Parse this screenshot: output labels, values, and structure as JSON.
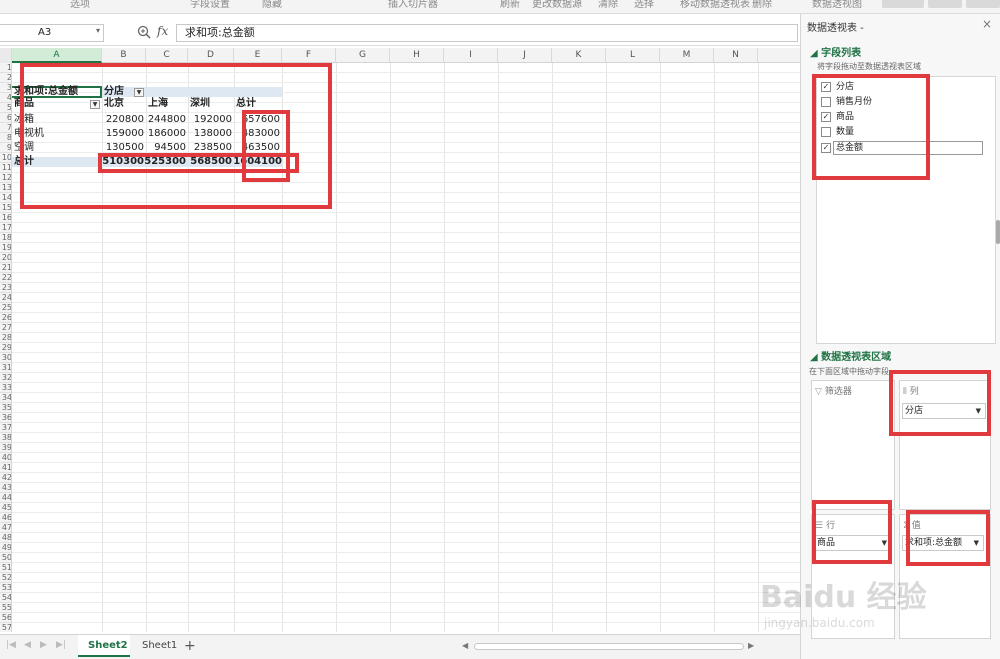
{
  "ribbon": {
    "partial_labels": [
      "选项",
      "字段设置",
      "隐藏",
      "插入切片器",
      "刷新",
      "更改数据源",
      "清除",
      "选择",
      "移动数据透视表",
      "删除",
      "数据透视图"
    ]
  },
  "formula_bar": {
    "cell_ref": "A3",
    "fx_label": "fx",
    "content": "求和项:总金额"
  },
  "columns": [
    "A",
    "B",
    "C",
    "D",
    "E",
    "F",
    "G",
    "H",
    "I",
    "J",
    "K",
    "L",
    "M",
    "N"
  ],
  "active_column": "A",
  "rows": [
    "1",
    "2",
    "3",
    "4",
    "5",
    "6",
    "7",
    "8",
    "9",
    "10",
    "11",
    "12",
    "13",
    "14",
    "15",
    "16",
    "17",
    "18",
    "19",
    "20",
    "21",
    "22",
    "23",
    "24",
    "25",
    "26",
    "27",
    "28",
    "29",
    "30",
    "31",
    "32",
    "33",
    "34",
    "35",
    "36",
    "37",
    "38",
    "39",
    "40",
    "41",
    "42",
    "43",
    "44",
    "45",
    "46",
    "47",
    "48",
    "49",
    "50",
    "51",
    "52",
    "53",
    "54",
    "55",
    "56",
    "57"
  ],
  "pivot": {
    "value_label": "求和项:总金额",
    "col_field": "分店",
    "row_field": "商品",
    "col_items": [
      "北京",
      "上海",
      "深圳",
      "总计"
    ],
    "rows": [
      {
        "label": "冰箱",
        "values": [
          "220800",
          "244800",
          "192000",
          "657600"
        ]
      },
      {
        "label": "电视机",
        "values": [
          "159000",
          "186000",
          "138000",
          "483000"
        ]
      },
      {
        "label": "空调",
        "values": [
          "130500",
          "94500",
          "238500",
          "463500"
        ]
      }
    ],
    "total": {
      "label": "总计",
      "values": [
        "510300",
        "525300",
        "568500",
        "1604100"
      ]
    }
  },
  "sheets": {
    "tabs": [
      "Sheet2",
      "Sheet1"
    ],
    "active": "Sheet2",
    "add": "+"
  },
  "pane": {
    "title": "数据透视表 -",
    "close": "×",
    "field_section": {
      "title": "字段列表",
      "hint": "将字段拖动至数据透视表区域"
    },
    "fields": [
      {
        "label": "分店",
        "checked": true
      },
      {
        "label": "销售月份",
        "checked": false
      },
      {
        "label": "商品",
        "checked": true
      },
      {
        "label": "数量",
        "checked": false
      },
      {
        "label": "总金额",
        "checked": true
      }
    ],
    "area_section": {
      "title": "数据透视表区域",
      "hint": "在下面区域中拖动字段"
    },
    "zones": {
      "filter": {
        "title": "筛选器",
        "icon": "filter-icon"
      },
      "columns": {
        "title": "列",
        "icon": "columns-icon",
        "field": "分店"
      },
      "rows": {
        "title": "行",
        "icon": "rows-icon",
        "field": "商品"
      },
      "values": {
        "title": "值",
        "icon": "sigma-icon",
        "field": "求和项:总金额"
      }
    }
  },
  "watermark": {
    "main": "Baidu 经验",
    "sub": "jingyan.baidu.com"
  },
  "colors": {
    "accent": "#217346",
    "highlight": "#e0393e",
    "pivot_header": "#dde8f3"
  }
}
